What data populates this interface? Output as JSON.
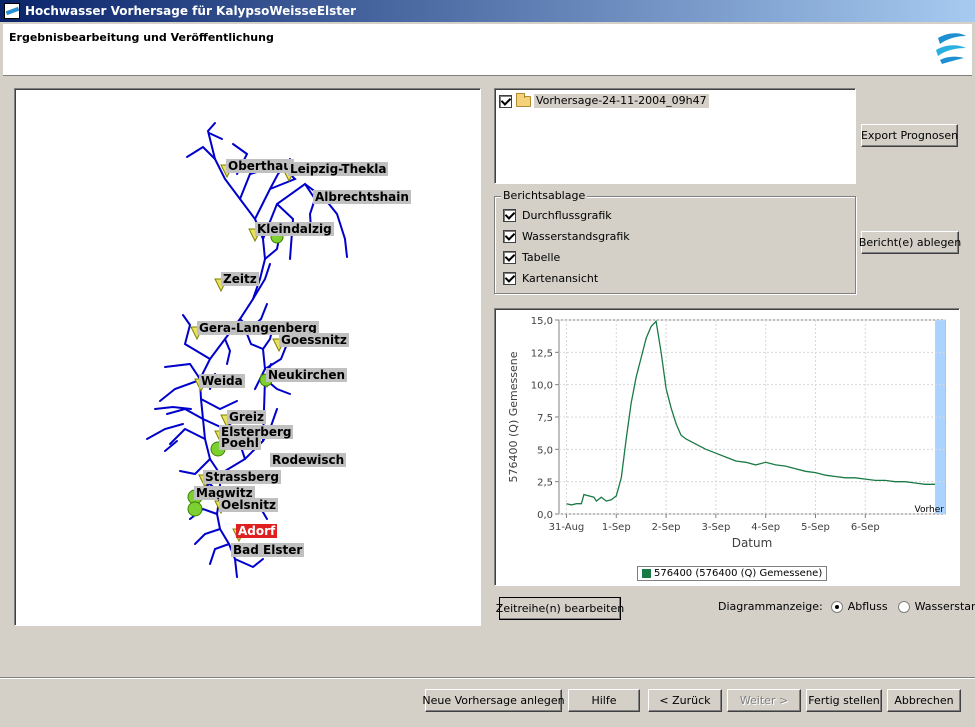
{
  "window": {
    "title": "Hochwasser Vorhersage für KalypsoWeisseElster"
  },
  "header": {
    "title": "Ergebnisbearbeitung und Veröffentlichung"
  },
  "map": {
    "stations": [
      {
        "name": "Oberthau",
        "symbol": "triangle-yellow",
        "status": "normal"
      },
      {
        "name": "Leipzig-Thekla",
        "symbol": "triangle-yellow",
        "status": "normal"
      },
      {
        "name": "Albrechtshain",
        "symbol": "none",
        "status": "normal"
      },
      {
        "name": "Kleindalzig",
        "symbol": "triangle-yellow",
        "status": "normal"
      },
      {
        "name": "Zeitz",
        "symbol": "triangle-yellow",
        "status": "normal"
      },
      {
        "name": "Gera-Langenberg",
        "symbol": "triangle-yellow",
        "status": "normal"
      },
      {
        "name": "Goessnitz",
        "symbol": "triangle-yellow",
        "status": "normal"
      },
      {
        "name": "Neukirchen",
        "symbol": "triangle-yellow",
        "status": "normal"
      },
      {
        "name": "Weida",
        "symbol": "triangle-yellow",
        "status": "normal"
      },
      {
        "name": "Greiz",
        "symbol": "triangle-yellow",
        "status": "normal"
      },
      {
        "name": "Elsterberg",
        "symbol": "triangle-yellow",
        "status": "normal"
      },
      {
        "name": "Poehl",
        "symbol": "circle-green",
        "status": "normal"
      },
      {
        "name": "Rodewisch",
        "symbol": "none",
        "status": "normal"
      },
      {
        "name": "Strassberg",
        "symbol": "triangle-yellow",
        "status": "normal"
      },
      {
        "name": "Magwitz",
        "symbol": "circle-green",
        "status": "normal"
      },
      {
        "name": "Oelsnitz",
        "symbol": "triangle-yellow",
        "status": "normal"
      },
      {
        "name": "Adorf",
        "symbol": "triangle-yellow",
        "status": "alert"
      },
      {
        "name": "Bad Elster",
        "symbol": "none",
        "status": "normal"
      }
    ],
    "colors": {
      "river": "#0000cc",
      "triangle": "#e8e060",
      "circle": "#7cd030",
      "label_bg": "#c0c0c0",
      "alert": "#e02020"
    }
  },
  "forecast_list": {
    "item_label": "Vorhersage-24-11-2004_09h47",
    "checked": true
  },
  "buttons": {
    "export": "Export Prognosen",
    "ablegen": "Bericht(e) ablegen",
    "zeitreihe": "Zeitreihe(n) bearbeiten",
    "neue": "Neue Vorhersage anlegen",
    "hilfe": "Hilfe",
    "zurueck": "< Zurück",
    "weiter": "Weiter >",
    "fertig": "Fertig stellen",
    "abbrechen": "Abbrechen"
  },
  "berichtsablage": {
    "title": "Berichtsablage",
    "items": [
      {
        "label": "Durchflussgrafik",
        "checked": true
      },
      {
        "label": "Wasserstandsgrafik",
        "checked": true
      },
      {
        "label": "Tabelle",
        "checked": true
      },
      {
        "label": "Kartenansicht",
        "checked": true
      }
    ]
  },
  "diagram": {
    "label": "Diagrammanzeige:",
    "options": [
      {
        "label": "Abfluss",
        "selected": true
      },
      {
        "label": "Wasserstand",
        "selected": false
      }
    ]
  },
  "chart_data": {
    "type": "line",
    "title": "",
    "xlabel": "Datum",
    "ylabel": "576400 (Q) Gemessene",
    "ylim": [
      0,
      15
    ],
    "yticks": [
      "0,0",
      "2,5",
      "5,0",
      "7,5",
      "10,0",
      "12,5",
      "15,0"
    ],
    "xticks": [
      "31-Aug",
      "1-Sep",
      "2-Sep",
      "3-Sep",
      "4-Sep",
      "5-Sep",
      "6-Sep"
    ],
    "xlim_days": [
      -0.15,
      7.6
    ],
    "grid": true,
    "forecast_label": "Vorher",
    "forecast_start_day": 7.4,
    "legend": "576400 (576400 (Q) Gemessene)",
    "series_color": "#1a7a46",
    "series": [
      {
        "name": "576400 (576400 (Q) Gemessene)",
        "x": [
          0.0,
          0.1,
          0.2,
          0.3,
          0.35,
          0.45,
          0.55,
          0.6,
          0.7,
          0.8,
          0.9,
          1.0,
          1.1,
          1.2,
          1.3,
          1.4,
          1.5,
          1.6,
          1.7,
          1.8,
          1.9,
          2.0,
          2.1,
          2.2,
          2.3,
          2.4,
          2.6,
          2.8,
          3.0,
          3.2,
          3.4,
          3.6,
          3.8,
          4.0,
          4.2,
          4.4,
          4.6,
          4.8,
          5.0,
          5.2,
          5.4,
          5.6,
          5.8,
          6.0,
          6.2,
          6.4,
          6.6,
          6.8,
          7.0,
          7.2,
          7.4
        ],
        "y": [
          0.8,
          0.7,
          0.8,
          0.8,
          1.5,
          1.4,
          1.3,
          1.0,
          1.3,
          1.0,
          1.1,
          1.4,
          2.8,
          5.8,
          8.6,
          10.6,
          12.1,
          13.6,
          14.5,
          14.9,
          12.5,
          9.7,
          8.2,
          7.0,
          6.1,
          5.8,
          5.4,
          5.0,
          4.7,
          4.4,
          4.1,
          4.0,
          3.8,
          4.0,
          3.8,
          3.7,
          3.5,
          3.3,
          3.2,
          3.0,
          2.9,
          2.8,
          2.8,
          2.7,
          2.6,
          2.6,
          2.5,
          2.5,
          2.4,
          2.3,
          2.3
        ]
      }
    ]
  }
}
